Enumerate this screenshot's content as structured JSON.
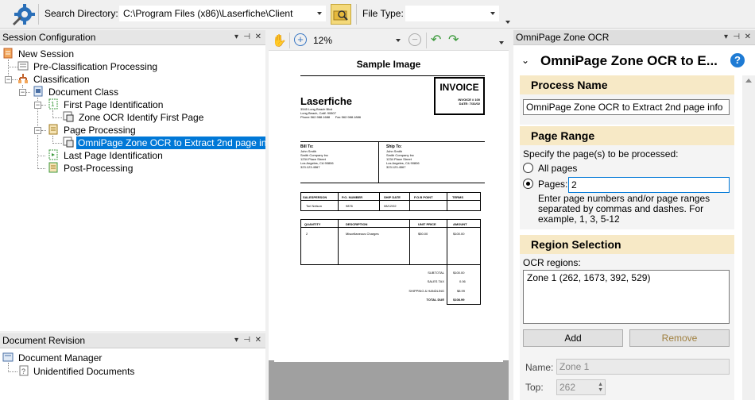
{
  "toolbar": {
    "search_directory_label": "Search Directory:",
    "search_directory_value": "C:\\Program Files (x86)\\Laserfiche\\Client",
    "file_type_label": "File Type:",
    "file_type_value": ""
  },
  "session_panel": {
    "title": "Session Configuration",
    "items": [
      {
        "label": "New Session"
      },
      {
        "label": "Pre-Classification Processing"
      },
      {
        "label": "Classification"
      },
      {
        "label": "Document Class"
      },
      {
        "label": "First Page Identification"
      },
      {
        "label": "Zone OCR Identify First Page"
      },
      {
        "label": "Page Processing"
      },
      {
        "label": "OmniPage Zone OCR to Extract 2nd page info"
      },
      {
        "label": "Last Page Identification"
      },
      {
        "label": "Post-Processing"
      }
    ]
  },
  "revision_panel": {
    "title": "Document Revision",
    "items": [
      {
        "label": "Document Manager"
      },
      {
        "label": "Unidentified Documents"
      }
    ]
  },
  "viewer": {
    "zoom": "12%",
    "page_title": "Sample Image",
    "invoice": {
      "title": "INVOICE",
      "number": "INVOICE # 100",
      "date": "DATE: 7/31/02",
      "logo": "Laserfiche",
      "address": [
        "3545 Long Beach Blvd",
        "Long Beach, Calif. 90807",
        "Phone 562.988.1688",
        "Fax 562.988.1886"
      ],
      "bill_to_label": "Bill To:",
      "bill_to": [
        "John Smith",
        "Smith Company Inc",
        "1234 Place Street",
        "Los Angeles, CA 90806",
        "323.123.4567"
      ],
      "ship_to_label": "Ship To:",
      "ship_to": [
        "John Smith",
        "Smith Company Inc",
        "1234 Place Street",
        "Los Angeles, CA 90806",
        "323.123.4567"
      ],
      "table1_headers": [
        "SALESPERSON",
        "P.O. NUMBER",
        "SHIP DATE",
        "F.O.B POINT",
        "TERMS"
      ],
      "table1_row": [
        "Tori Nelson",
        "9876",
        "08/12/02",
        "",
        ""
      ],
      "table2_headers": [
        "QUANTITY",
        "DESCRIPTION",
        "UNIT PRICE",
        "AMOUNT"
      ],
      "table2_row": [
        "2",
        "Miscellaneous Charges",
        "$50.00",
        "$100.00"
      ],
      "totals": [
        {
          "label": "SUBTOTAL",
          "value": "$100.00"
        },
        {
          "label": "SALES TAX",
          "value": "0.06"
        },
        {
          "label": "SHIPPING & HANDLING",
          "value": "$8.99"
        },
        {
          "label": "TOTAL DUE",
          "value": "$108.99"
        }
      ]
    }
  },
  "right_panel": {
    "header": "OmniPage Zone OCR",
    "title": "OmniPage Zone OCR to E...",
    "process_name_heading": "Process Name",
    "process_name_value": "OmniPage Zone OCR to Extract 2nd page info",
    "page_range_heading": "Page Range",
    "page_range_prompt": "Specify the page(s) to be processed:",
    "all_pages_label": "All pages",
    "pages_label": "Pages:",
    "pages_value": "2",
    "pages_hint": "Enter page numbers and/or page ranges separated by commas and dashes.  For example, 1, 3, 5-12",
    "region_heading": "Region Selection",
    "ocr_regions_label": "OCR regions:",
    "ocr_regions": [
      "Zone 1 (262, 1673, 392, 529)"
    ],
    "add_label": "Add",
    "remove_label": "Remove",
    "name_label": "Name:",
    "name_value": "Zone 1",
    "top_label": "Top:",
    "top_value": "262"
  }
}
